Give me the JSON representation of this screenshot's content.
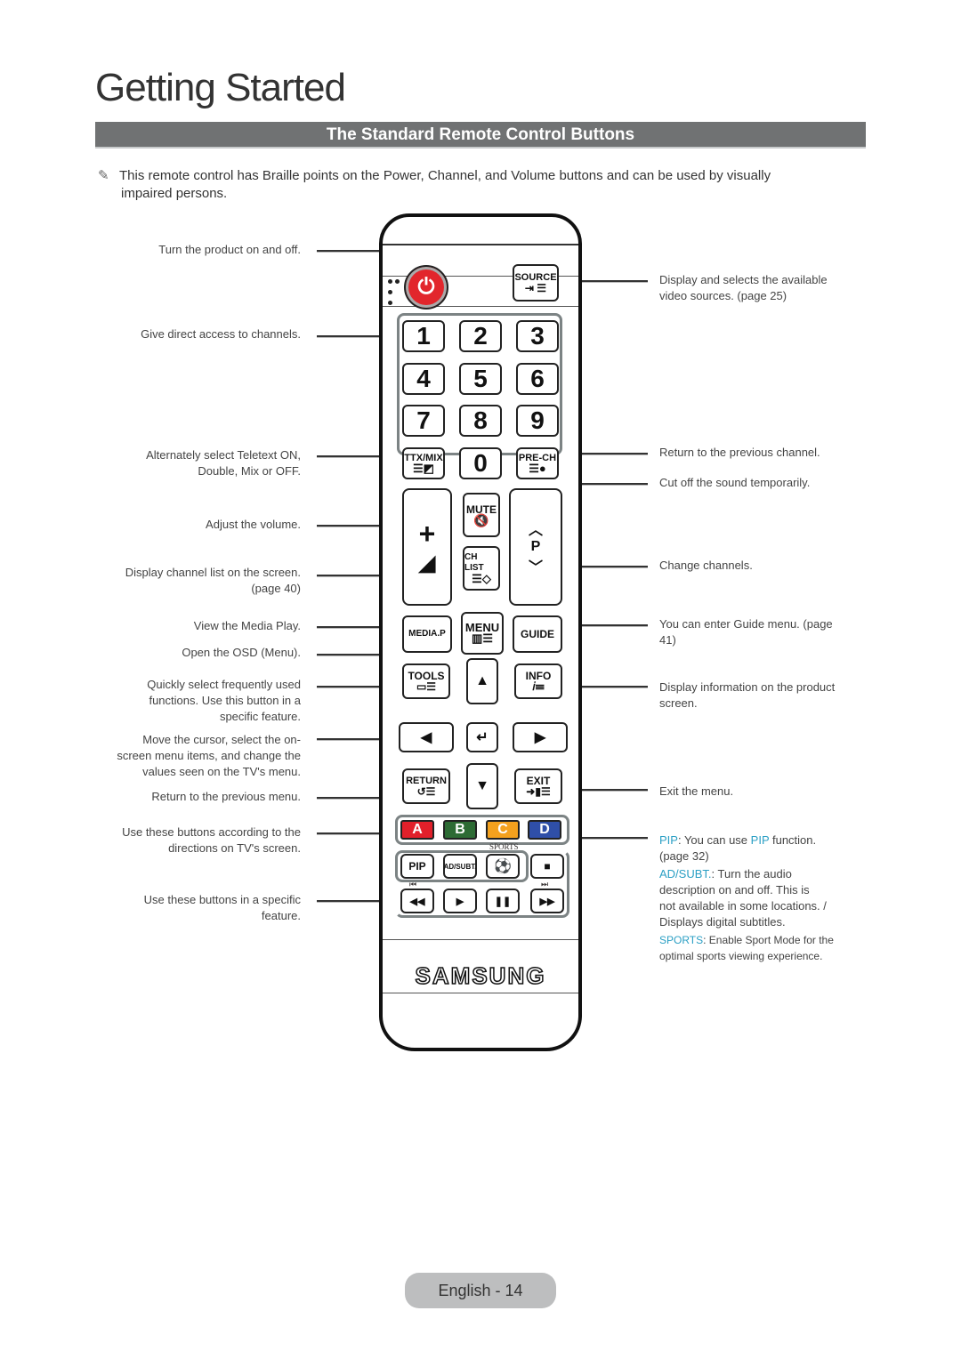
{
  "page": {
    "title": "Getting Started",
    "section_title": "The Standard Remote Control Buttons",
    "note_icon": "pencil-note-icon",
    "note_line1": "This remote control has Braille points on the Power, Channel, and Volume buttons and can be used by visually",
    "note_line2": "impaired persons.",
    "footer": "English - 14"
  },
  "left_labels": [
    {
      "line1": "Turn the product on and off.",
      "line2": ""
    },
    {
      "line1": "Give direct access to channels.",
      "line2": ""
    },
    {
      "line1": "Alternately select Teletext ON,",
      "line2": "Double, Mix or OFF."
    },
    {
      "line1": "Adjust the volume.",
      "line2": ""
    },
    {
      "line1": "Display channel list on the screen.",
      "line2": "(page 40)"
    },
    {
      "line1": "View the Media Play.",
      "line2": ""
    },
    {
      "line1": "Open the OSD (Menu).",
      "line2": ""
    },
    {
      "line1": "Quickly select frequently used",
      "line2": "functions. Use this button in a",
      "line3": "specific feature."
    },
    {
      "line1": "Move the cursor, select the on-",
      "line2": "screen menu items, and change the",
      "line3": "values seen on the TV's menu."
    },
    {
      "line1": "Return to the previous menu.",
      "line2": ""
    },
    {
      "line1": "Use these buttons according to the",
      "line2": "directions on TV's screen."
    },
    {
      "line1": "Use these buttons in a specific",
      "line2": "feature."
    }
  ],
  "right_labels": {
    "source": {
      "line1": "Display and selects the available",
      "line2": "video sources. (page 25)"
    },
    "prech": "Return to the previous channel.",
    "mute": "Cut off the sound temporarily.",
    "channel": "Change channels.",
    "guide": {
      "line1": "You can enter Guide menu. (page",
      "line2": "41)"
    },
    "info": {
      "line1": "Display information on the product",
      "line2": "screen."
    },
    "exit": "Exit the menu.",
    "pip": {
      "key": "PIP",
      "text1": ": You can use ",
      "key2": "PIP",
      "text2": " function.",
      "line2": "(page 32)"
    },
    "adsubt": {
      "key": "AD/SUBT.",
      "text1": ": Turn the audio",
      "line2": "description on and off. This is",
      "line3": "not available in some locations. /",
      "line4": "Displays digital subtitles."
    },
    "sports": {
      "key": "SPORTS",
      "text1": ": Enable Sport Mode for the",
      "line2": "optimal sports viewing experience."
    }
  },
  "remote": {
    "brand": "SAMSUNG",
    "source": "SOURCE",
    "digits": [
      "1",
      "2",
      "3",
      "4",
      "5",
      "6",
      "7",
      "8",
      "9",
      "0"
    ],
    "ttx": "TTX/MIX",
    "prech": "PRE-CH",
    "mute": "MUTE",
    "chlist": "CH LIST",
    "p": "P",
    "mediap": "MEDIA.P",
    "menu": "MENU",
    "guide": "GUIDE",
    "tools": "TOOLS",
    "info": "INFO",
    "return": "RETURN",
    "exit": "EXIT",
    "colors": [
      {
        "label": "A",
        "color": "#e1202a"
      },
      {
        "label": "B",
        "color": "#2d6b34"
      },
      {
        "label": "C",
        "color": "#f4a11e"
      },
      {
        "label": "D",
        "color": "#2f4fa8"
      }
    ],
    "sports": "SPORTS",
    "pip": "PIP",
    "adsubt": "AD/SUBT.",
    "stop": "■",
    "rew": "◀◀",
    "play": "▶",
    "pause": "❚❚",
    "ff": "▶▶",
    "prev": "⏮",
    "next": "⏭",
    "power_color": "#e2262c"
  }
}
